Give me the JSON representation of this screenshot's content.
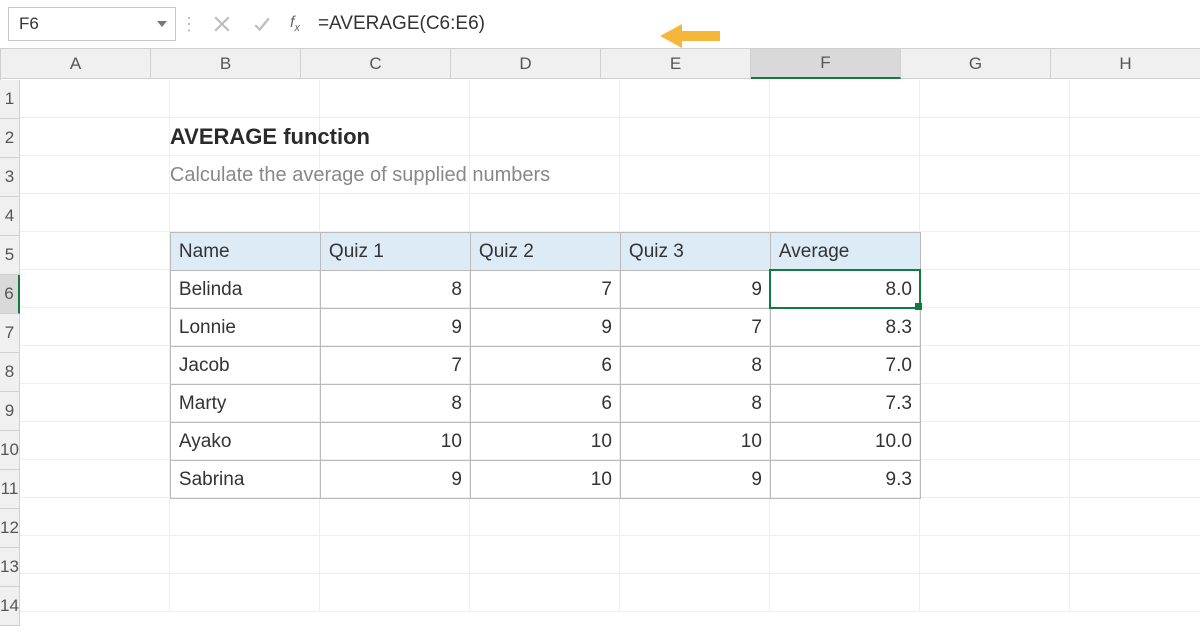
{
  "name_box": {
    "value": "F6"
  },
  "formula_bar": {
    "formula": "=AVERAGE(C6:E6)"
  },
  "columns": [
    "A",
    "B",
    "C",
    "D",
    "E",
    "F",
    "G",
    "H"
  ],
  "rows": [
    1,
    2,
    3,
    4,
    5,
    6,
    7,
    8,
    9,
    10,
    11,
    12,
    13,
    14
  ],
  "active": {
    "col_index": 5,
    "row_index": 5
  },
  "title": "AVERAGE function",
  "subtitle": "Calculate the average of supplied numbers",
  "table": {
    "headers": [
      "Name",
      "Quiz 1",
      "Quiz 2",
      "Quiz 3",
      "Average"
    ],
    "rows": [
      {
        "name": "Belinda",
        "q1": "8",
        "q2": "7",
        "q3": "9",
        "avg": "8.0"
      },
      {
        "name": "Lonnie",
        "q1": "9",
        "q2": "9",
        "q3": "7",
        "avg": "8.3"
      },
      {
        "name": "Jacob",
        "q1": "7",
        "q2": "6",
        "q3": "8",
        "avg": "7.0"
      },
      {
        "name": "Marty",
        "q1": "8",
        "q2": "6",
        "q3": "8",
        "avg": "7.3"
      },
      {
        "name": "Ayako",
        "q1": "10",
        "q2": "10",
        "q3": "10",
        "avg": "10.0"
      },
      {
        "name": "Sabrina",
        "q1": "9",
        "q2": "10",
        "q3": "9",
        "avg": "9.3"
      }
    ]
  }
}
